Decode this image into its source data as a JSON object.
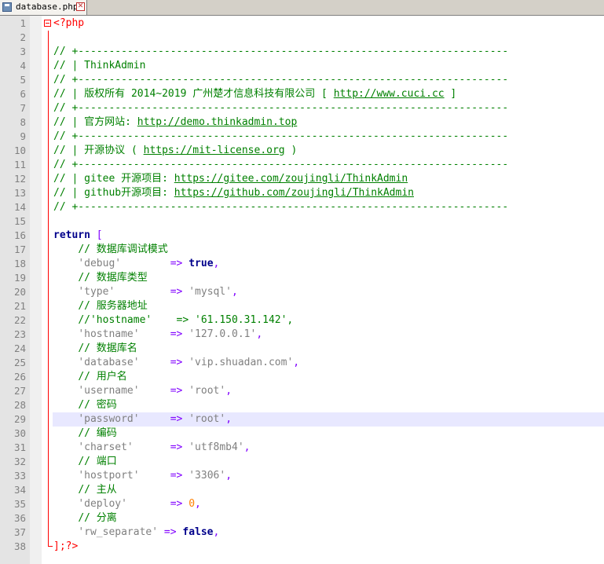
{
  "tab": {
    "title": "database.php",
    "close_glyph": "✕"
  },
  "code": {
    "open_tag": "<?php",
    "close_tag": "];?>",
    "rule": "// +----------------------------------------------------------------------",
    "app_name": "// | ThinkAdmin",
    "copyright_prefix": "// | 版权所有 2014~2019 广州楚才信息科技有限公司 [ ",
    "copyright_url": "http://www.cuci.cc",
    "copyright_suffix": " ]",
    "site_prefix": "// | 官方网站: ",
    "site_url": "http://demo.thinkadmin.top",
    "license_prefix": "// | 开源协议 ( ",
    "license_url": "https://mit-license.org",
    "license_suffix": " )",
    "gitee_prefix": "// | gitee 开源项目: ",
    "gitee_url": "https://gitee.com/zoujingli/ThinkAdmin",
    "github_prefix": "// | github开源项目: ",
    "github_url": "https://github.com/zoujingli/ThinkAdmin",
    "return_kw": "return",
    "return_bracket": " [",
    "arrow": "=>",
    "comma": ",",
    "c_type": "// 数据库调试模式",
    "k_debug": "'debug'",
    "v_debug": "true",
    "c_dbtype": "// 数据库类型",
    "k_type": "'type'",
    "v_type": "'mysql'",
    "c_server": "// 服务器地址",
    "commented_host": "//'hostname'    => '61.150.31.142',",
    "k_hostname": "'hostname'",
    "v_hostname": "'127.0.0.1'",
    "c_dbname": "// 数据库名",
    "k_database": "'database'",
    "v_database": "'vip.shuadan.com'",
    "c_user": "// 用户名",
    "k_username": "'username'",
    "v_username": "'root'",
    "c_pass": "// 密码",
    "k_password": "'password'",
    "v_password": "'root'",
    "c_charset": "// 编码",
    "k_charset": "'charset'",
    "v_charset": "'utf8mb4'",
    "c_port": "// 端口",
    "k_hostport": "'hostport'",
    "v_hostport": "'3306'",
    "c_deploy": "// 主从",
    "k_deploy": "'deploy'",
    "v_deploy": "0",
    "c_separate": "// 分离",
    "k_rw": "'rw_separate'",
    "v_rw": "false"
  },
  "line_numbers": [
    "1",
    "2",
    "3",
    "4",
    "5",
    "6",
    "7",
    "8",
    "9",
    "10",
    "11",
    "12",
    "13",
    "14",
    "15",
    "16",
    "17",
    "18",
    "19",
    "20",
    "21",
    "22",
    "23",
    "24",
    "25",
    "26",
    "27",
    "28",
    "29",
    "30",
    "31",
    "32",
    "33",
    "34",
    "35",
    "36",
    "37",
    "38"
  ],
  "colors": {
    "comment": "#008000",
    "keyword": "#00008b",
    "string": "#808080",
    "operator": "#8000ff",
    "number": "#ff8000",
    "tag": "#ff0000",
    "current_line": "#e8e8ff"
  }
}
